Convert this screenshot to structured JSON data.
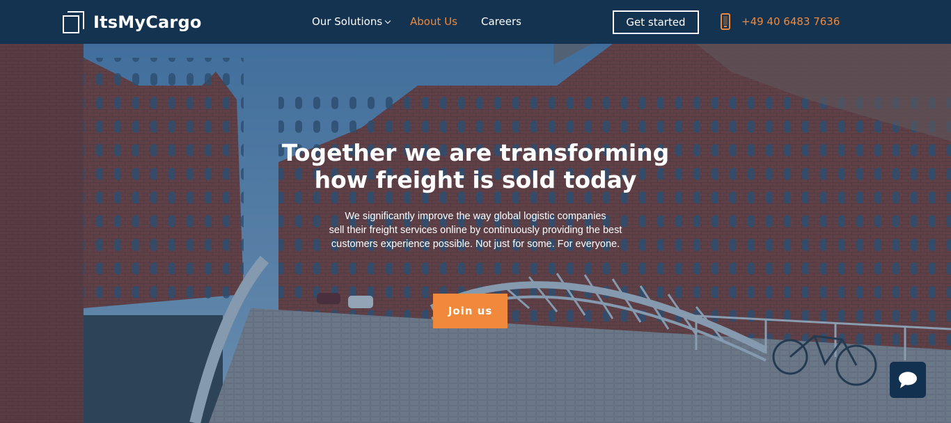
{
  "brand": {
    "name": "ItsMyCargo"
  },
  "nav": {
    "solutions": "Our Solutions",
    "about": "About Us",
    "careers": "Careers",
    "cta": "Get started",
    "phone": "+49 40 6483 7636"
  },
  "hero": {
    "title_line1": "Together we are transforming",
    "title_line2": "how freight is sold today",
    "sub_line1": "We significantly improve the way global logistic companies",
    "sub_line2": "sell their freight services online by continuously providing the best",
    "sub_line3": "customers experience possible. Not just for some. For everyone.",
    "cta": "Join us"
  },
  "colors": {
    "navbar": "#133350",
    "accent": "#f0893b",
    "text": "#ffffff"
  },
  "icons": {
    "phone": "phone-icon",
    "chevron": "chevron-down-icon",
    "chat": "chat-icon"
  }
}
